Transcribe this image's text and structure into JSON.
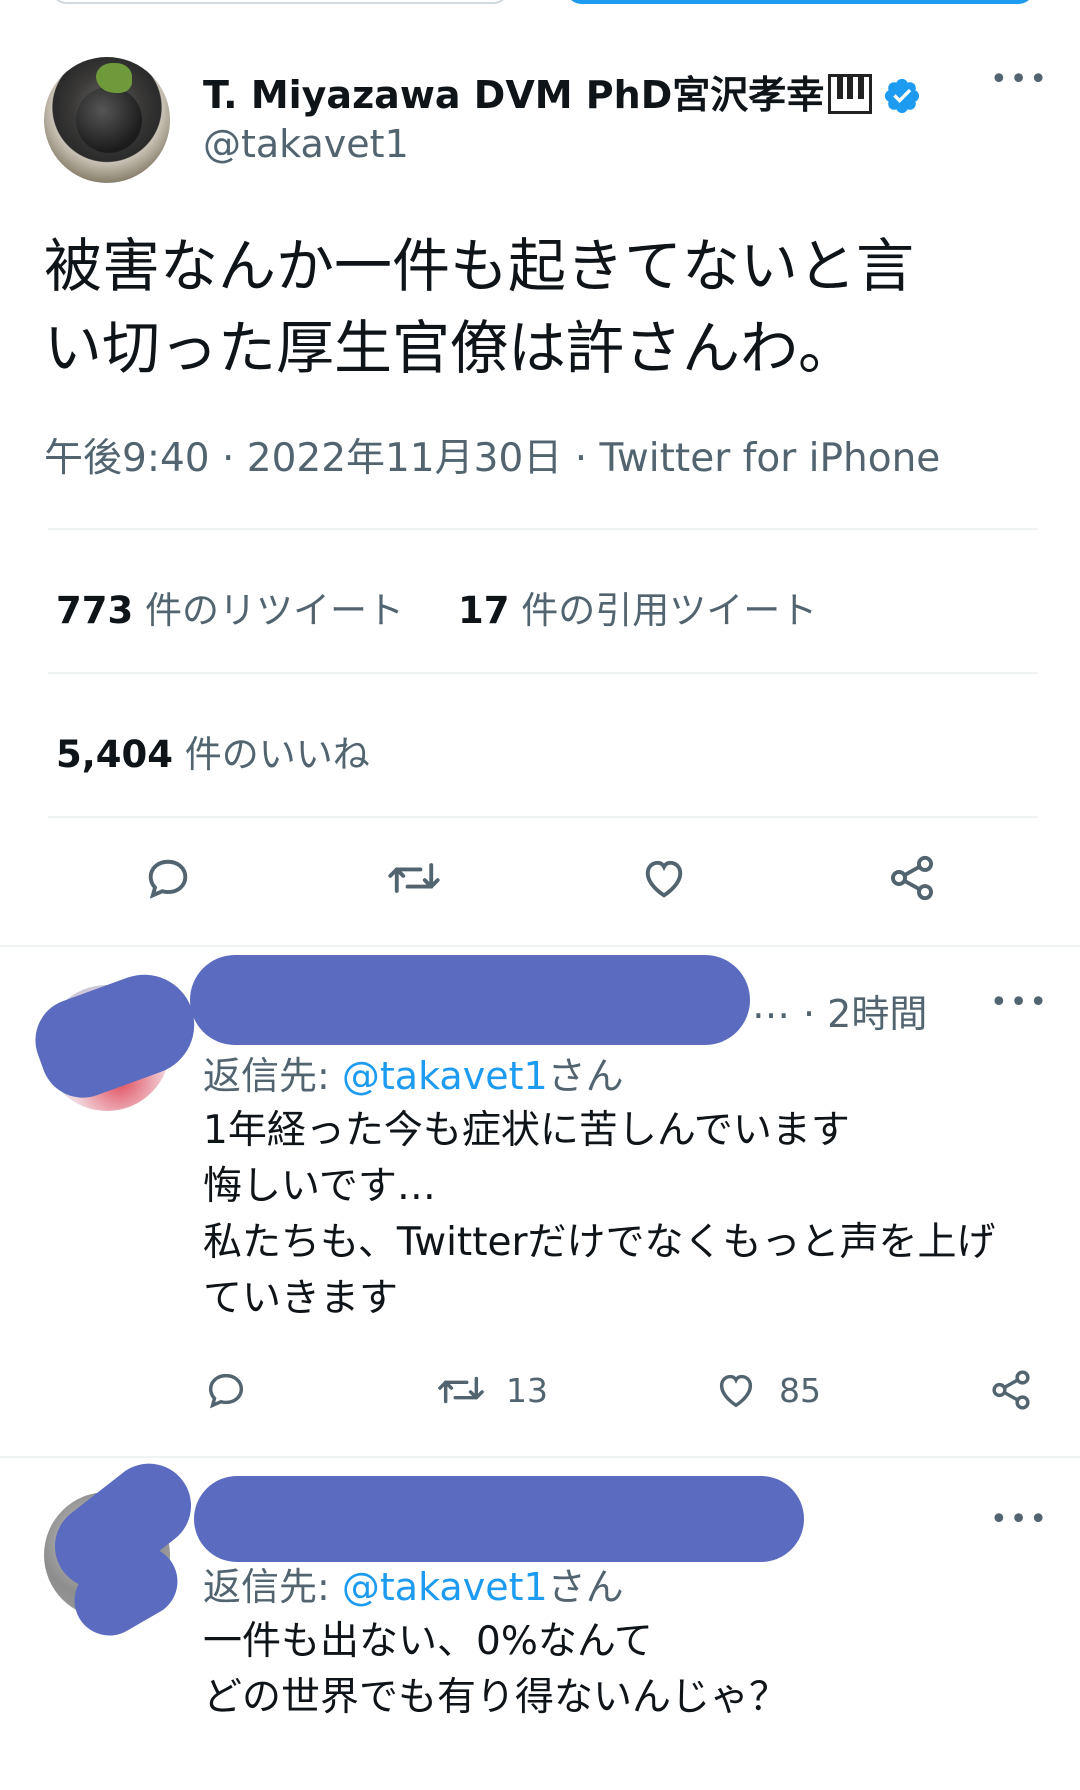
{
  "tweet": {
    "display_name": "T. Miyazawa DVM PhD宮沢孝幸",
    "handle": "@takavet1",
    "more": "•••",
    "text": "被害なんか一件も起きてないと言\nい切った厚生官僚は許さんわ。",
    "time": "午後9:40",
    "date": "2022年11月30日",
    "source": "Twitter for iPhone",
    "separator": " · ",
    "stats": {
      "retweets_count": "773",
      "retweets_label": " 件のリツイート",
      "quotes_count": "17",
      "quotes_label": " 件の引用ツイート",
      "likes_count": "5,404",
      "likes_label": " 件のいいね"
    },
    "icons": [
      "reply-icon",
      "retweet-icon",
      "like-icon",
      "share-icon",
      "verified-icon",
      "piano-icon"
    ]
  },
  "replies": [
    {
      "name_suffix": "…",
      "time": "· 2時間",
      "more": "•••",
      "reply_to_prefix": "返信先: ",
      "reply_to_mention": "@takavet1",
      "reply_to_suffix": "さん",
      "body": "1年経った今も症状に苦しんでいます\n悔しいです…\n私たちも、Twitterだけでなくもっと声を上げ\nていきます",
      "retweets": "13",
      "likes": "85"
    },
    {
      "more": "•••",
      "reply_to_prefix": "返信先: ",
      "reply_to_mention": "@takavet1",
      "reply_to_suffix": "さん",
      "body": "一件も出ない、0%なんて\nどの世界でも有り得ないんじゃ？"
    }
  ],
  "colors": {
    "primary_text": "#0f1419",
    "secondary_text": "#536471",
    "link": "#1d9bf0",
    "divider": "#eff3f4",
    "redaction": "#5b6bbf"
  }
}
